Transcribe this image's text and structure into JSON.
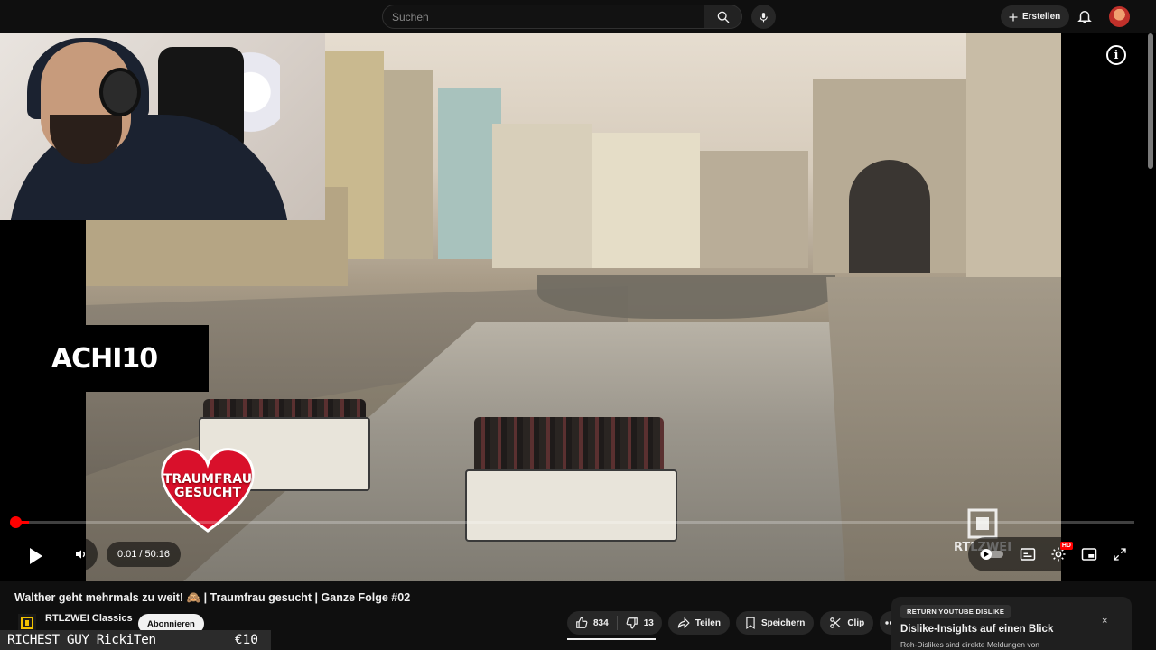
{
  "header": {
    "search_placeholder": "Suchen",
    "create_label": "Erstellen"
  },
  "video": {
    "overlay_logo_text": "ACHI10",
    "overlay_heart_text_1": "TRAUMFRAU",
    "overlay_heart_text_2": "GESUCHT",
    "channel_watermark": "RTLZWEI",
    "current_time": "0:01",
    "time_separator": "/",
    "duration": "50:16",
    "progress_fraction": 0.0003,
    "quality_badge": "HD"
  },
  "meta": {
    "title": "Walther geht mehrmals zu weit! 🙈 | Traumfrau gesucht | Ganze Folge #02",
    "channel_name": "RTLZWEI Classics",
    "subscribe_label": "Abonnieren"
  },
  "actions": {
    "likes": "834",
    "dislikes": "13",
    "share_label": "Teilen",
    "save_label": "Speichern",
    "clip_label": "Clip"
  },
  "dislike_card": {
    "badge": "RETURN YOUTUBE DISLIKE",
    "title": "Dislike-Insights auf einen Blick",
    "description": "Roh-Dislikes sind direkte Meldungen von",
    "close": "×"
  },
  "donation": {
    "name": "RICHEST GUY RickiTen",
    "amount": "€10"
  },
  "colors": {
    "accent": "#ff0000",
    "background": "#0f0f0f",
    "pill": "#272727"
  }
}
